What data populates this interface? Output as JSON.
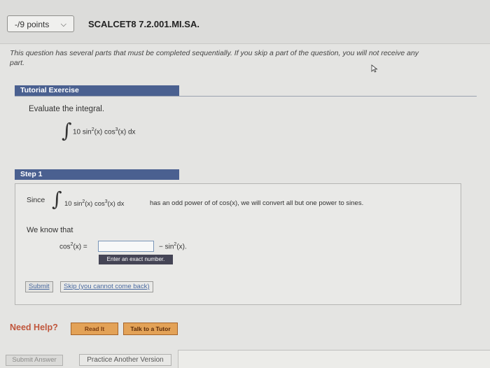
{
  "header": {
    "points_label": "-/9 points",
    "question_id": "SCALCET8 7.2.001.MI.SA."
  },
  "intro": {
    "line1": "This question has several parts that must be completed sequentially. If you skip a part of the question, you will not receive any",
    "line2": "part."
  },
  "tutorial": {
    "header": "Tutorial Exercise",
    "instruction": "Evaluate the integral.",
    "integral_symbol": "∫",
    "integrand": {
      "coef": "10 sin",
      "p1": "2",
      "mid": "(x) cos",
      "p2": "3",
      "end": "(x) dx"
    }
  },
  "step1": {
    "header": "Step 1",
    "since_label": "Since",
    "integral_symbol": "∫",
    "integrand": {
      "coef": "10 sin",
      "p1": "2",
      "mid": "(x) cos",
      "p2": "3",
      "end": "(x) dx"
    },
    "since_rest": "has an odd power of of cos(x), we will convert all but one power to sines.",
    "we_know": "We know that",
    "lhs": {
      "fn": "cos",
      "pow": "2",
      "rest": "(x) ="
    },
    "answer_value": "",
    "rhs": {
      "prefix": "− sin",
      "pow": "2",
      "rest": "(x)."
    },
    "tooltip": "Enter an exact number.",
    "submit_label": "Submit",
    "skip_label": "Skip (you cannot come back)"
  },
  "help": {
    "label": "Need Help?",
    "read_it": "Read It",
    "talk_tutor": "Talk to a Tutor"
  },
  "footer": {
    "submit_answer": "Submit Answer",
    "practice": "Practice Another Version"
  },
  "colors": {
    "accent_header": "#4a6090",
    "help_button": "#e3a257",
    "need_help_text": "#c0563c"
  }
}
